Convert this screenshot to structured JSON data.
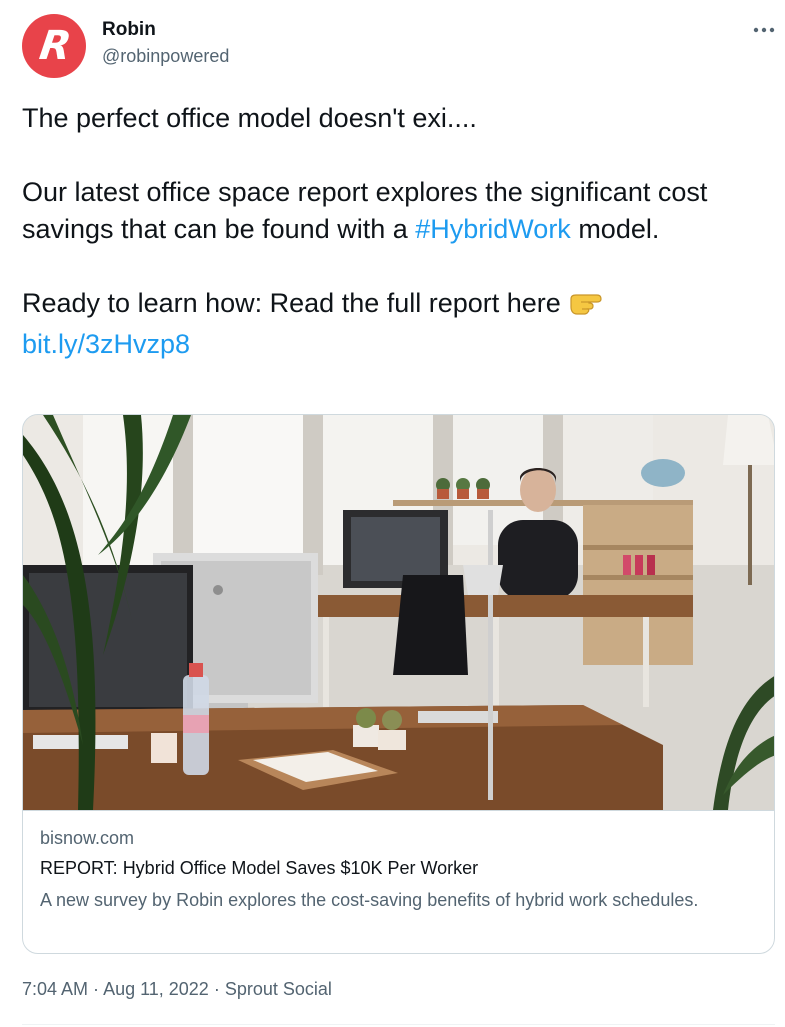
{
  "author": {
    "display_name": "Robin",
    "handle": "@robinpowered",
    "avatar_letter": "R",
    "avatar_color": "#e8434a"
  },
  "tweet": {
    "line1": "The perfect office model doesn't exi....",
    "para2_before": "Our latest office space report explores the significant cost savings that can be found with a ",
    "hashtag": "#HybridWork",
    "para2_after": " model.",
    "para3": "Ready to learn how: Read the full report here",
    "emoji_icon": "backhand-index-pointing-right-icon",
    "link": "bit.ly/3zHvzp8",
    "link_color": "#1d9bf0"
  },
  "card": {
    "domain": "bisnow.com",
    "title": "REPORT: Hybrid Office Model Saves $10K Per Worker",
    "description": "A new survey by Robin explores the cost-saving benefits of hybrid work schedules."
  },
  "meta": {
    "time": "7:04 AM",
    "separator": " · ",
    "date": "Aug 11, 2022",
    "source": "Sprout Social"
  }
}
